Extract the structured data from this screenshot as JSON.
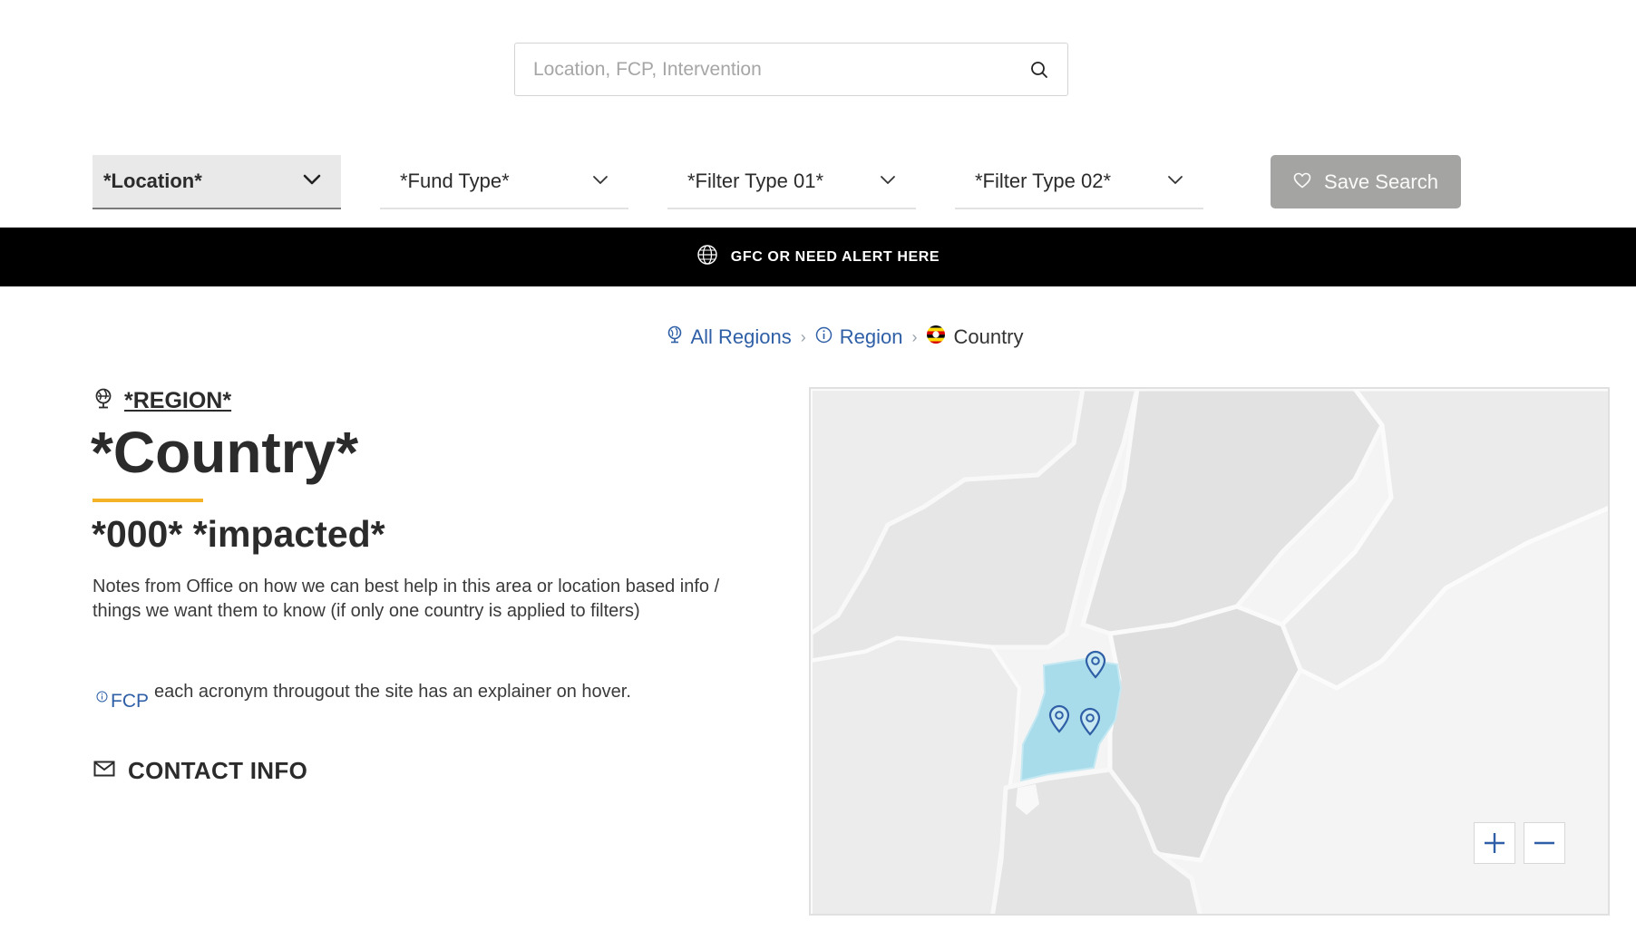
{
  "search": {
    "placeholder": "Location, FCP, Intervention"
  },
  "filters": [
    {
      "label": "*Location*"
    },
    {
      "label": "*Fund Type*"
    },
    {
      "label": "*Filter Type 01*"
    },
    {
      "label": "*Filter Type 02*"
    }
  ],
  "save_search": {
    "label": "Save Search"
  },
  "alert": {
    "text": "GFC OR NEED ALERT HERE"
  },
  "breadcrumb": {
    "all_regions": "All Regions",
    "region": "Region",
    "country": "Country"
  },
  "region": {
    "label": "*REGION*"
  },
  "country": {
    "title": "*Country*",
    "impacted": "*000* *impacted*",
    "notes": "Notes from Office on how we can best help in this area or location based info / things we want them to know (if only one country is applied to filters)"
  },
  "acronym": {
    "term": "FCP",
    "text": "each acronym througout the site has an explainer on hover."
  },
  "contact": {
    "label": "CONTACT INFO"
  },
  "colors": {
    "link": "#2f5fa6",
    "accent": "#f4b226",
    "highlight": "#a8dcea",
    "button": "#a4a4a2"
  },
  "map": {
    "pins": 3,
    "zoom_controls": [
      "plus-icon",
      "minus-icon"
    ]
  }
}
